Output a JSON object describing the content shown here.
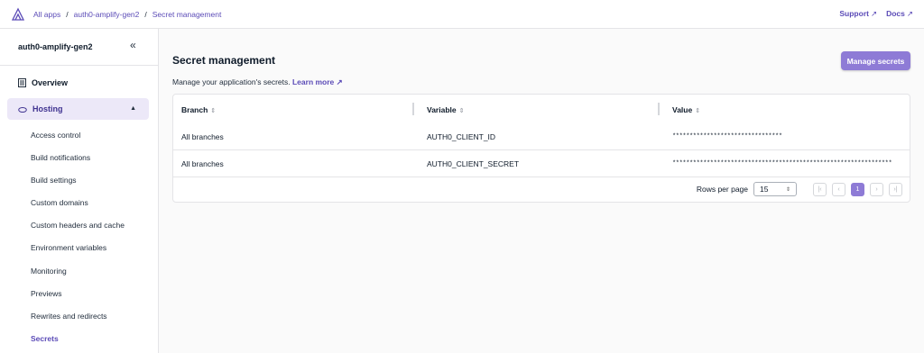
{
  "breadcrumb": {
    "items": [
      "All apps",
      "auth0-amplify-gen2",
      "Secret management"
    ],
    "separator": "/"
  },
  "top_links": {
    "support": "Support",
    "docs": "Docs"
  },
  "sidebar": {
    "app_name": "auth0-amplify-gen2",
    "collapse_icon": "«",
    "overview": "Overview",
    "hosting": "Hosting",
    "sub_items": [
      "Access control",
      "Build notifications",
      "Build settings",
      "Custom domains",
      "Custom headers and cache",
      "Environment variables",
      "Monitoring",
      "Previews",
      "Rewrites and redirects",
      "Secrets"
    ],
    "active_item": "Secrets"
  },
  "main": {
    "title": "Secret management",
    "description": "Manage your application's secrets.",
    "learn_more": "Learn more",
    "manage_button": "Manage secrets"
  },
  "table": {
    "columns": [
      "Branch",
      "Variable",
      "Value"
    ],
    "rows": [
      {
        "branch": "All branches",
        "variable": "AUTH0_CLIENT_ID",
        "value": "********************************"
      },
      {
        "branch": "All branches",
        "variable": "AUTH0_CLIENT_SECRET",
        "value": "****************************************************************"
      }
    ]
  },
  "pagination": {
    "rows_per_page_label": "Rows per page",
    "rows_per_page_value": "15",
    "current_page": "1"
  },
  "colors": {
    "accent": "#8e7bd6",
    "link": "#5b4bb7",
    "active_bg": "#ece8f8"
  }
}
